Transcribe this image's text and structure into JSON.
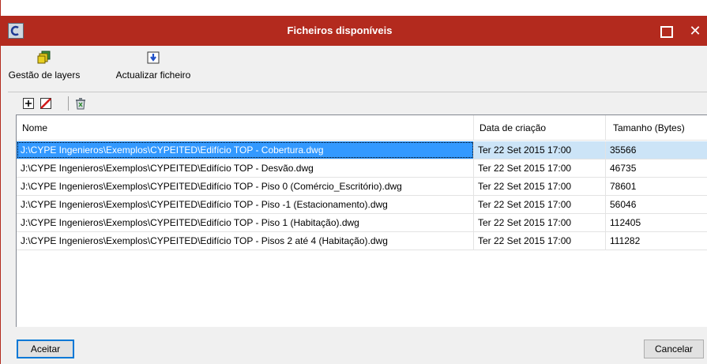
{
  "window": {
    "title": "Ficheiros disponíveis",
    "title_bar_color": "#b32a1e",
    "icons": {
      "app": "cype-app-icon",
      "maximize": "maximize-icon",
      "close": "close-icon"
    },
    "close_glyph": "✕"
  },
  "toolbar": {
    "layers_label": "Gestão de layers",
    "layers_icon": "layers-icon",
    "update_label": "Actualizar ficheiro",
    "update_icon": "update-file-icon"
  },
  "file_toolbar": {
    "icons": [
      "add-file-icon",
      "delete-file-icon",
      "recycle-icon"
    ]
  },
  "table": {
    "columns": [
      "Nome",
      "Data de criação",
      "Tamanho (Bytes)"
    ],
    "rows": [
      {
        "name": "J:\\CYPE Ingenieros\\Exemplos\\CYPEITED\\Edifício TOP - Cobertura.dwg",
        "date": "Ter 22 Set 2015  17:00",
        "size": "35566"
      },
      {
        "name": "J:\\CYPE Ingenieros\\Exemplos\\CYPEITED\\Edifício TOP - Desvão.dwg",
        "date": "Ter 22 Set 2015  17:00",
        "size": "46735"
      },
      {
        "name": "J:\\CYPE Ingenieros\\Exemplos\\CYPEITED\\Edifício TOP - Piso 0 (Comércio_Escritório).dwg",
        "date": "Ter 22 Set 2015  17:00",
        "size": "78601"
      },
      {
        "name": "J:\\CYPE Ingenieros\\Exemplos\\CYPEITED\\Edifício TOP - Piso -1 (Estacionamento).dwg",
        "date": "Ter 22 Set 2015  17:00",
        "size": "56046"
      },
      {
        "name": "J:\\CYPE Ingenieros\\Exemplos\\CYPEITED\\Edifício TOP - Piso 1 (Habitação).dwg",
        "date": "Ter 22 Set 2015  17:00",
        "size": "112405"
      },
      {
        "name": "J:\\CYPE Ingenieros\\Exemplos\\CYPEITED\\Edifício TOP - Pisos 2 até 4 (Habitação).dwg",
        "date": "Ter 22 Set 2015  17:00",
        "size": "111282"
      }
    ],
    "selected_row": 0
  },
  "buttons": {
    "accept": "Aceitar",
    "cancel": "Cancelar"
  }
}
